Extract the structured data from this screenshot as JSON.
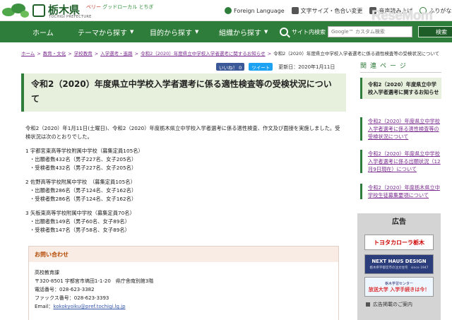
{
  "header": {
    "logo_text": "栃木県",
    "logo_sub": "TOCHIGI PREFECTURE",
    "tag_red": "ベリー",
    "tag_green": "グッドローカル とちぎ",
    "links": [
      {
        "label": "Foreign Language",
        "icon": "globe-icon"
      },
      {
        "label": "文字サイズ・色合い変更",
        "icon": "text-size-icon"
      },
      {
        "label": "音声読み上げ",
        "icon": "speaker-icon"
      },
      {
        "label": "ふりがな表示",
        "icon": "furigana-icon"
      }
    ],
    "watermark": "ReseMom"
  },
  "nav": {
    "items": [
      "ホーム",
      "テーマから探す",
      "目的から探す",
      "組織から探す"
    ],
    "search_label": "サイト内検索",
    "search_placeholder": "Google™ カスタム検索",
    "search_button": "検索"
  },
  "breadcrumb": [
    "ホーム",
    "教育・文化",
    "学校教育",
    "入学選考・進路",
    "令和2（2020）年度県立中学校入学者選考に関するお知らせ",
    "令和2（2020）年度県立中学校入学者選考に係る適性検査等の受検状況について"
  ],
  "share": {
    "facebook_label": "いいね！ 0",
    "twitter_label": "ツイート",
    "updated": "更新日：2020年1月11日"
  },
  "article": {
    "title": "令和2（2020）年度県立中学校入学者選考に係る適性検査等の受検状況について",
    "intro": "令和2（2020）年1月11日(土曜日)、令和2（2020）年度栃木県立中学校入学者選考に係る適性検査、作文及び面接を実施しました。受検状況は次のとおりでした。",
    "schools": [
      {
        "name": "1 宇都宮東高等学校附属中学校（募集定員105名）",
        "applicants": "・出願者数432名（男子227名、女子205名）",
        "examinees": "・受検者数432名（男子227名、女子205名）"
      },
      {
        "name": "2 佐野高等学校附属中学校　（募集定員105名）",
        "applicants": "・出願者数286名（男子124名、女子162名）",
        "examinees": "・受検者数286名（男子124名、女子162名）"
      },
      {
        "name": "3 矢板東高等学校附属中学校（募集定員70名）",
        "applicants": "・出願者数149名（男子60名、女子89名）",
        "examinees": "・受検者数147名（男子58名、女子89名）"
      }
    ]
  },
  "inquiry": {
    "heading": "お問い合わせ",
    "department": "高校教育課",
    "address": "〒320-8501 宇都宮市塙田1-1-20　県庁舎南別館3階",
    "phone": "電話番号：028-623-3382",
    "fax": "ファックス番号：028-623-3393",
    "email_label": "Email：",
    "email": "kokokyoiku@pref.tochigi.lg.jp"
  },
  "sidebar": {
    "related_heading": "関連ページ",
    "items": [
      {
        "label": "令和2（2020）年度県立中学校入学者選考に関するお知らせ",
        "current": true
      },
      {
        "label": "令和2（2020）年度県立中学校入学者選考に係る適性検査等の受検状況について",
        "current": false
      },
      {
        "label": "令和2（2020）年度県立中学校入学者選考に係る出願状況（12月9日現在）について",
        "current": false
      },
      {
        "label": "令和2（2020）年度栃木県立中学校生徒募集要項について",
        "current": false
      }
    ],
    "ad_heading": "広告",
    "ads": [
      "トヨタカローラ栃木",
      "NEXT HAUS DESIGN",
      "放送大学 入学手続きは今！"
    ],
    "ad2_sub": "栃木県宇都宮市の注文住宅　since 1947",
    "ad3_sub": "栃木学習センター",
    "ad_footer": "広告掲載のご案内"
  },
  "colors": {
    "nav_green": "#2f7d3a",
    "title_bg": "#e6f0dc",
    "link_purple": "#7a2a8f",
    "inquiry_accent": "#b34700"
  }
}
